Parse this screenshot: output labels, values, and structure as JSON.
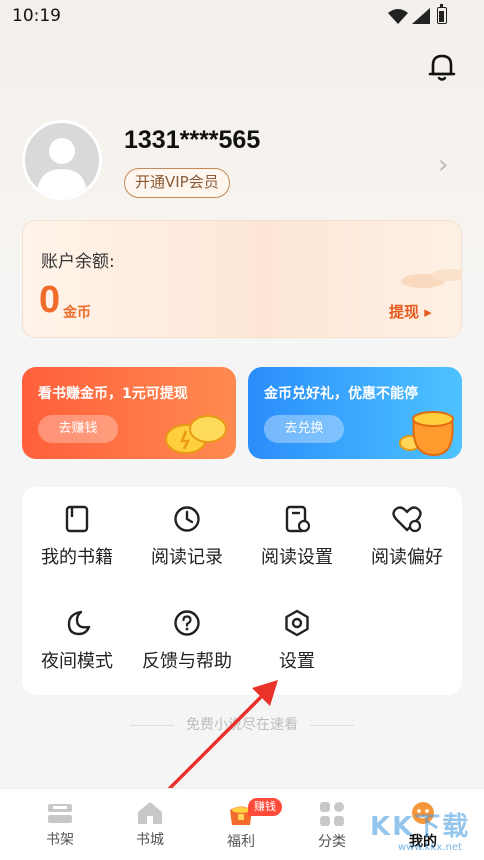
{
  "status": {
    "time": "10:19"
  },
  "profile": {
    "phone": "1331****565",
    "vip_label": "开通VIP会员"
  },
  "balance": {
    "label": "账户余额:",
    "value": "0",
    "unit": "金币",
    "withdraw_label": "提现 ▸"
  },
  "promos": [
    {
      "title": "看书赚金币，1元可提现",
      "button": "去赚钱"
    },
    {
      "title": "金币兑好礼，优惠不能停",
      "button": "去兑换"
    }
  ],
  "menu": [
    {
      "label": "我的书籍",
      "icon": "book-icon"
    },
    {
      "label": "阅读记录",
      "icon": "clock-icon"
    },
    {
      "label": "阅读设置",
      "icon": "reading-settings-icon"
    },
    {
      "label": "阅读偏好",
      "icon": "heart-icon"
    },
    {
      "label": "夜间模式",
      "icon": "moon-icon"
    },
    {
      "label": "反馈与帮助",
      "icon": "help-icon"
    },
    {
      "label": "设置",
      "icon": "hexagon-settings-icon"
    }
  ],
  "slogan": "免费小说尽在速看",
  "tabs": [
    {
      "label": "书架",
      "icon": "shelf-icon"
    },
    {
      "label": "书城",
      "icon": "home-icon"
    },
    {
      "label": "福利",
      "icon": "gift-icon"
    },
    {
      "label": "分类",
      "icon": "grid-icon"
    },
    {
      "label": "我的",
      "icon": "profile-icon"
    }
  ],
  "earn_badge": "赚钱",
  "watermark": {
    "text": "KK下载",
    "url": "www.kkx.net"
  },
  "colors": {
    "accent": "#f06c2a",
    "promo_orange": "#ff5f3b",
    "promo_blue": "#2a8dfb"
  }
}
